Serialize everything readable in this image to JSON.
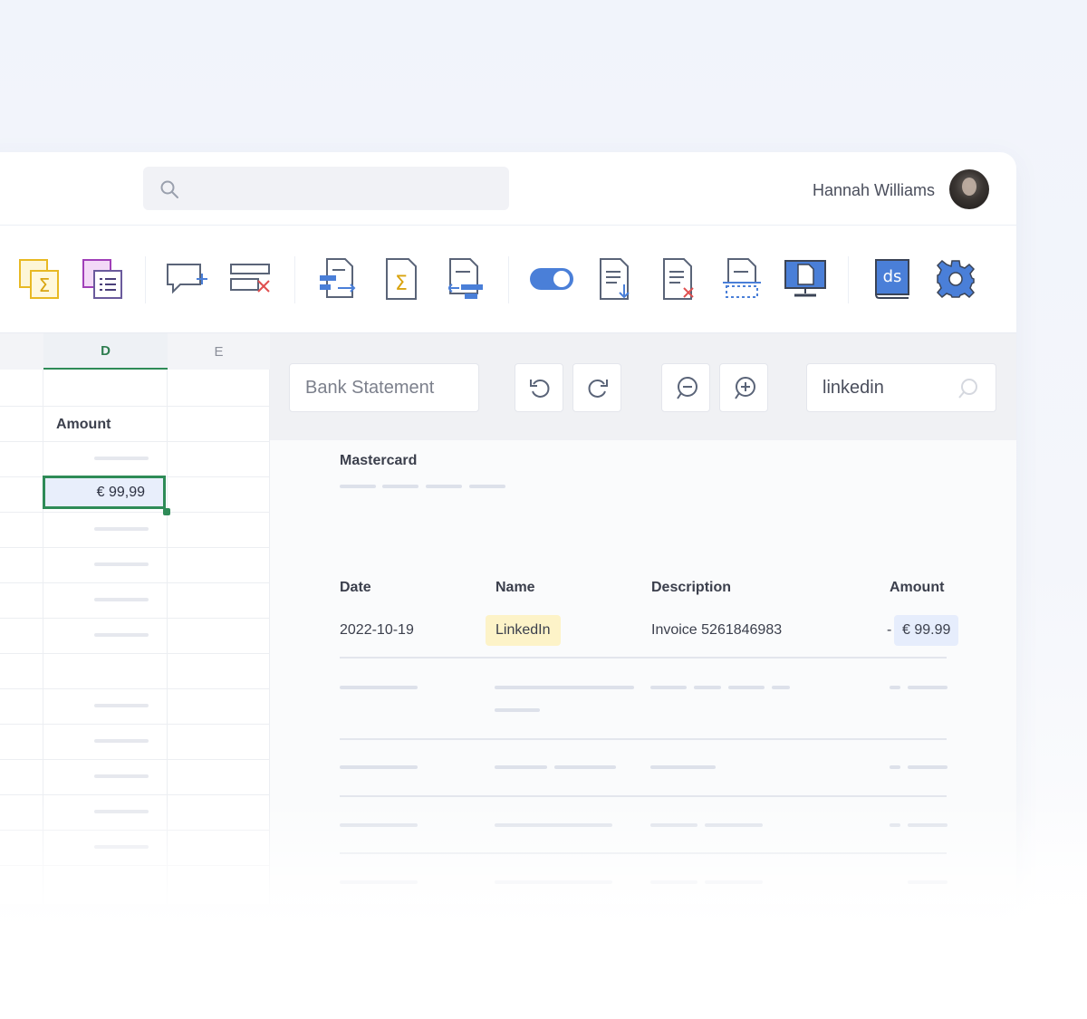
{
  "header": {
    "search_placeholder": "",
    "user_name": "Hannah Williams"
  },
  "toolbar": {
    "icons": [
      "sum-sheet-icon",
      "list-sheet-icon",
      "add-comment-icon",
      "delete-row-icon",
      "doc-transfer-icon",
      "doc-sum-icon",
      "doc-link-icon",
      "toggle-icon",
      "doc-download-icon",
      "doc-delete-icon",
      "doc-frame-icon",
      "monitor-doc-icon",
      "ds-book-icon",
      "gear-icon"
    ]
  },
  "sheet": {
    "columns": [
      "D",
      "E"
    ],
    "amount_header": "Amount",
    "selected_value": "€ 99,99"
  },
  "panel": {
    "document_field": "Bank Statement",
    "search_value": "linkedin",
    "account_title": "Mastercard",
    "table": {
      "headers": [
        "Date",
        "Name",
        "Description",
        "Amount"
      ],
      "row": {
        "date": "2022-10-19",
        "name": "LinkedIn",
        "description": "Invoice 5261846983",
        "sign": "-",
        "amount": "€ 99.99"
      }
    }
  },
  "colors": {
    "accent_green": "#2e8b57",
    "highlight_yellow": "#fdf3c8",
    "highlight_blue": "#e6edfc",
    "icon_blue": "#4a7fd8"
  }
}
